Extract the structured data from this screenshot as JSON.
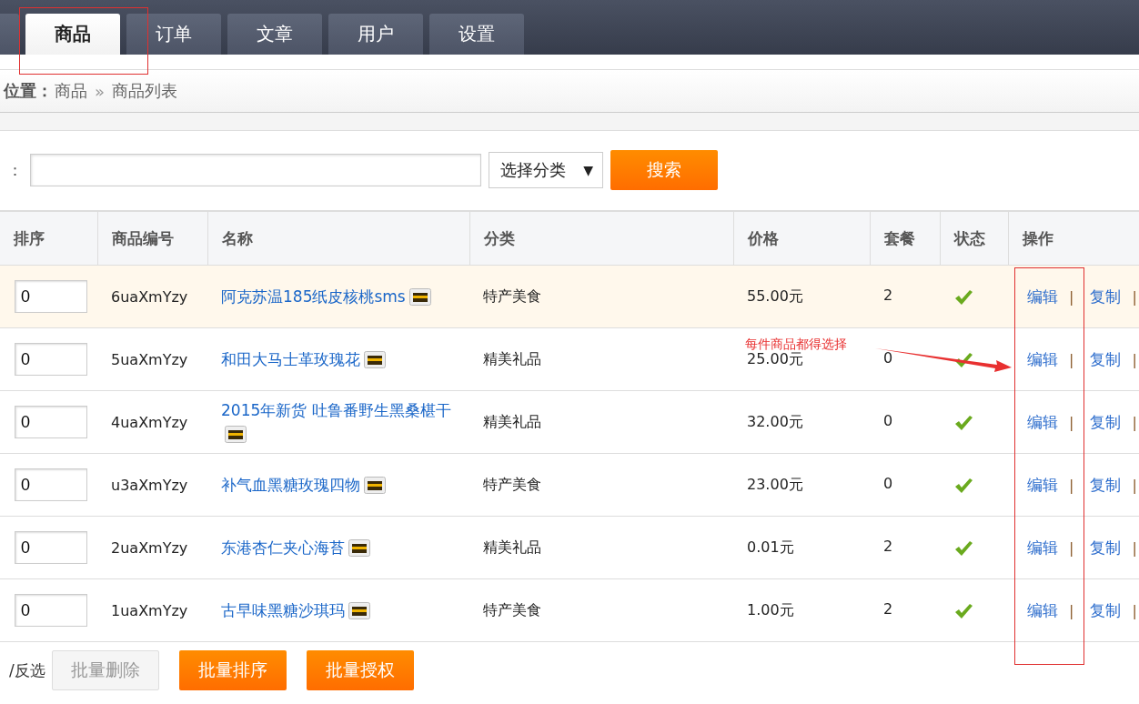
{
  "tabs": [
    {
      "selected": false
    },
    {
      "label": "商品",
      "selected": true
    },
    {
      "label": "订单",
      "selected": false
    },
    {
      "label": "文章",
      "selected": false
    },
    {
      "label": "用户",
      "selected": false
    },
    {
      "label": "设置",
      "selected": false
    }
  ],
  "breadcrumb": {
    "label": "位置：",
    "items": [
      "商品",
      "商品列表"
    ],
    "separator": "»"
  },
  "search": {
    "label": "：",
    "category": "选择分类",
    "caret": "▼",
    "button": "搜索"
  },
  "table": {
    "columns": [
      "排序",
      "商品编号",
      "名称",
      "分类",
      "价格",
      "套餐",
      "状态",
      "操作"
    ],
    "rows": [
      {
        "order": "0",
        "code": "6uaXmYzy",
        "name": "阿克苏温185纸皮核桃sms",
        "category": "特产美食",
        "price": "55.00元",
        "package": "2",
        "enabled": true,
        "highlighted": true,
        "actions": [
          {
            "kind": "link",
            "label": "编辑"
          },
          {
            "kind": "separator",
            "label": "|"
          },
          {
            "kind": "link",
            "label": "复制"
          },
          {
            "kind": "separator",
            "label": "|"
          }
        ]
      },
      {
        "order": "0",
        "code": "5uaXmYzy",
        "name": "和田大马士革玫瑰花",
        "category": "精美礼品",
        "price": "25.00元",
        "package": "0",
        "enabled": true,
        "highlighted": false,
        "actions": [
          {
            "kind": "link",
            "label": "编辑"
          },
          {
            "kind": "separator",
            "label": "|"
          },
          {
            "kind": "link",
            "label": "复制"
          },
          {
            "kind": "separator",
            "label": "|"
          }
        ]
      },
      {
        "order": "0",
        "code": "4uaXmYzy",
        "name": "2015年新货 吐鲁番野生黑桑椹干",
        "category": "精美礼品",
        "price": "32.00元",
        "package": "0",
        "enabled": true,
        "highlighted": false,
        "actions": [
          {
            "kind": "link",
            "label": "编辑"
          },
          {
            "kind": "separator",
            "label": "|"
          },
          {
            "kind": "link",
            "label": "复制"
          },
          {
            "kind": "separator",
            "label": "|"
          }
        ]
      },
      {
        "order": "0",
        "code": "u3aXmYzy",
        "name": "补气血黑糖玫瑰四物",
        "category": "特产美食",
        "price": "23.00元",
        "package": "0",
        "enabled": true,
        "highlighted": false,
        "actions": [
          {
            "kind": "link",
            "label": "编辑"
          },
          {
            "kind": "separator",
            "label": "|"
          },
          {
            "kind": "link",
            "label": "复制"
          },
          {
            "kind": "separator",
            "label": "|"
          }
        ]
      },
      {
        "order": "0",
        "code": "2uaXmYzy",
        "name": "东港杏仁夹心海苔",
        "category": "精美礼品",
        "price": "0.01元",
        "package": "2",
        "enabled": true,
        "highlighted": false,
        "actions": [
          {
            "kind": "link",
            "label": "编辑"
          },
          {
            "kind": "separator",
            "label": "|"
          },
          {
            "kind": "link",
            "label": "复制"
          },
          {
            "kind": "separator",
            "label": "|"
          }
        ]
      },
      {
        "order": "0",
        "code": "1uaXmYzy",
        "name": "古早味黑糖沙琪玛",
        "category": "特产美食",
        "price": "1.00元",
        "package": "2",
        "enabled": true,
        "highlighted": false,
        "actions": [
          {
            "kind": "link",
            "label": "编辑"
          },
          {
            "kind": "separator",
            "label": "|"
          },
          {
            "kind": "link",
            "label": "复制"
          },
          {
            "kind": "separator",
            "label": "|"
          }
        ]
      }
    ]
  },
  "footer": {
    "select_label": "/反选",
    "buttons": [
      {
        "label": "批量删除",
        "disabled": true
      },
      {
        "label": "批量排序",
        "disabled": false
      },
      {
        "label": "批量授权",
        "disabled": false
      }
    ]
  },
  "annotation": {
    "note": "每件商品都得选择"
  }
}
